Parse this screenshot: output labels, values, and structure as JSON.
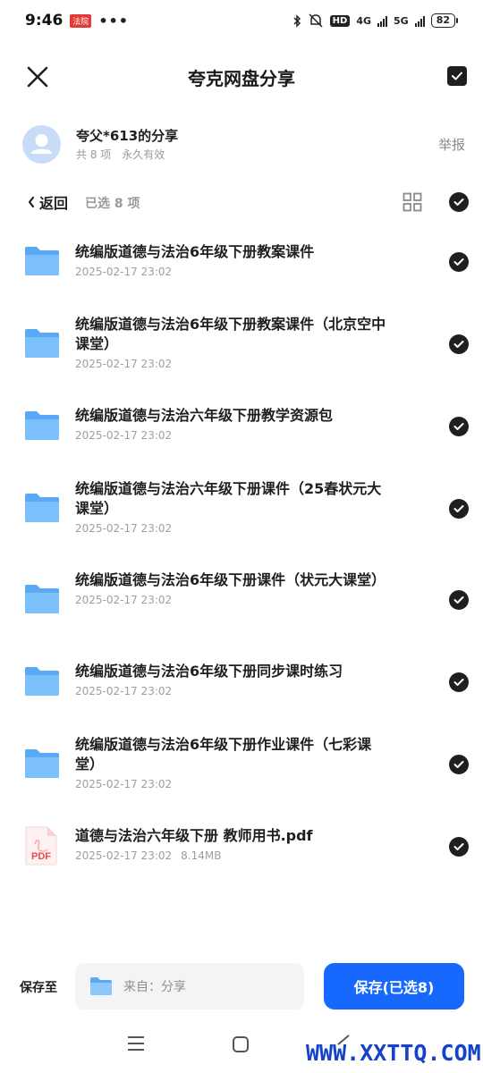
{
  "status_bar": {
    "time": "9:46",
    "badge": "法院",
    "dots": "•••",
    "hd": "HD",
    "net1": "4G",
    "net2": "5G",
    "battery": "82"
  },
  "header": {
    "title": "夸克网盘分享"
  },
  "sharer": {
    "name": "夸父*613的分享",
    "count": "共 8 项",
    "validity": "永久有效",
    "report": "举报"
  },
  "nav": {
    "back": "返回",
    "selected": "已选 8 项"
  },
  "files": [
    {
      "name": "统编版道德与法治6年级下册教案课件",
      "date": "2025-02-17 23:02",
      "size": "",
      "type": "folder"
    },
    {
      "name": "统编版道德与法治6年级下册教案课件（北京空中课堂）",
      "date": "2025-02-17 23:02",
      "size": "",
      "type": "folder"
    },
    {
      "name": "统编版道德与法治六年级下册教学资源包",
      "date": "2025-02-17 23:02",
      "size": "",
      "type": "folder"
    },
    {
      "name": "统编版道德与法治六年级下册课件（25春状元大课堂）",
      "date": "2025-02-17 23:02",
      "size": "",
      "type": "folder"
    },
    {
      "name": "统编版道德与法治6年级下册课件（状元大课堂）",
      "date": "2025-02-17 23:02",
      "size": "",
      "type": "folder"
    },
    {
      "name": "统编版道德与法治6年级下册同步课时练习",
      "date": "2025-02-17 23:02",
      "size": "",
      "type": "folder"
    },
    {
      "name": "统编版道德与法治6年级下册作业课件（七彩课堂）",
      "date": "2025-02-17 23:02",
      "size": "",
      "type": "folder"
    },
    {
      "name": "道德与法治六年级下册 教师用书.pdf",
      "date": "2025-02-17 23:02",
      "size": "8.14MB",
      "type": "pdf"
    }
  ],
  "pdf_label": "PDF",
  "bottom": {
    "save_to": "保存至",
    "destination": "来自：分享",
    "save_button": "保存(已选8)"
  },
  "watermark": "WWW.XXTTQ.COM",
  "colors": {
    "accent": "#1768ff",
    "folder": "#5aa9f5",
    "check": "#1f1f1f",
    "muted": "#9e9e9e"
  }
}
